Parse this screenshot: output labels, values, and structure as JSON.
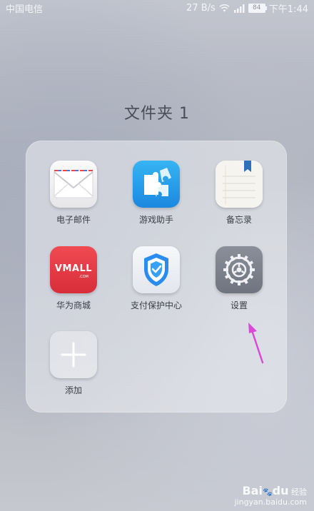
{
  "status_bar": {
    "carrier": "中国电信",
    "speed": "27 B/s",
    "battery": "84",
    "time": "下午1:44"
  },
  "folder": {
    "title": "文件夹 1",
    "apps": [
      {
        "label": "电子邮件",
        "icon": "mail-icon"
      },
      {
        "label": "游戏助手",
        "icon": "game-assistant-icon"
      },
      {
        "label": "备忘录",
        "icon": "memo-icon"
      },
      {
        "label": "华为商城",
        "icon": "vmall-icon"
      },
      {
        "label": "支付保护中心",
        "icon": "payment-protection-icon"
      },
      {
        "label": "设置",
        "icon": "settings-icon"
      },
      {
        "label": "添加",
        "icon": "add-icon"
      }
    ],
    "vmall_logo": "VMALL",
    "vmall_logo_sub": ".COM"
  },
  "colors": {
    "annotation_arrow": "#d94bd6",
    "vmall_red": "#e63845",
    "game_blue": "#2a9ff0"
  },
  "watermark": {
    "brand": "Bai",
    "paw": "du",
    "suffix": "经验",
    "url": "jingyan.baidu.com"
  }
}
